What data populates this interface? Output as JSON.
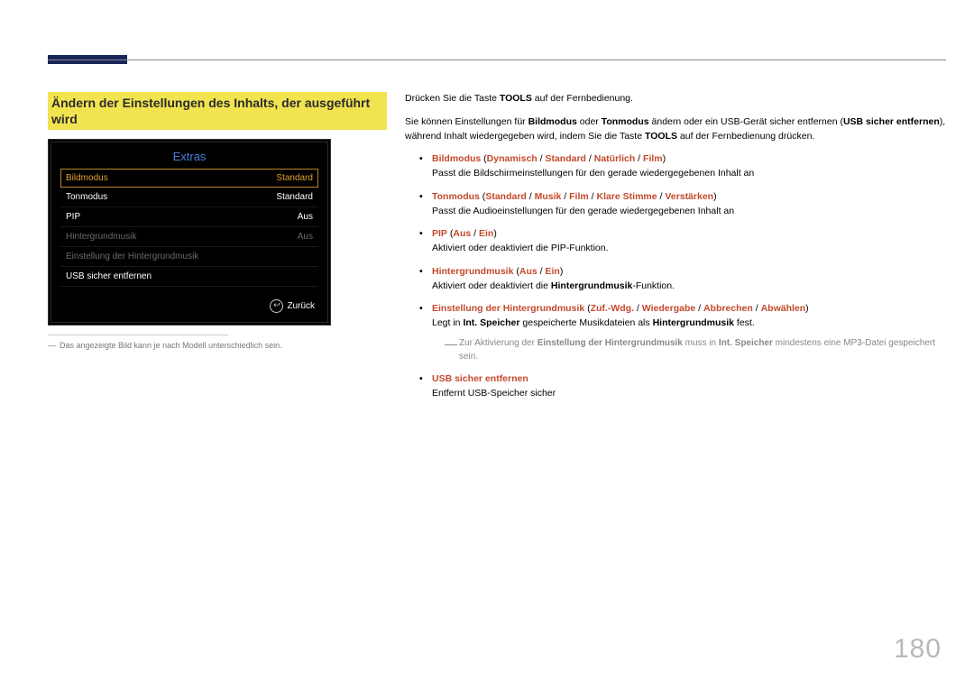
{
  "page_number": "180",
  "heading": "Ändern der Einstellungen des Inhalts, der ausgeführt wird",
  "tv_panel": {
    "title": "Extras",
    "rows": [
      {
        "label": "Bildmodus",
        "value": "Standard",
        "state": "selected"
      },
      {
        "label": "Tonmodus",
        "value": "Standard",
        "state": "light"
      },
      {
        "label": "PIP",
        "value": "Aus",
        "state": "light"
      },
      {
        "label": "Hintergrundmusik",
        "value": "Aus",
        "state": "dim"
      },
      {
        "label": "Einstellung der Hintergrundmusik",
        "value": "",
        "state": "dim"
      },
      {
        "label": "USB sicher entfernen",
        "value": "",
        "state": "light"
      }
    ],
    "footer_label": "Zurück"
  },
  "image_footnote": "Das angezeigte Bild kann je nach Modell unterschiedlich sein.",
  "body": {
    "intro1_a": "Drücken Sie die Taste ",
    "intro1_b": "TOOLS",
    "intro1_c": " auf der Fernbedienung.",
    "intro2_a": "Sie können Einstellungen für ",
    "intro2_b": "Bildmodus",
    "intro2_c": " oder ",
    "intro2_d": "Tonmodus",
    "intro2_e": " ändern oder ein USB-Gerät sicher entfernen (",
    "intro2_f": "USB sicher entfernen",
    "intro2_g": "), während Inhalt wiedergegeben wird, indem Sie die Taste ",
    "intro2_h": "TOOLS",
    "intro2_i": " auf der Fernbedienung drücken.",
    "items": [
      {
        "title_parts": [
          "Bildmodus",
          " (",
          "Dynamisch",
          " / ",
          "Standard",
          " / ",
          "Natürlich",
          " / ",
          "Film",
          ")"
        ],
        "desc": "Passt die Bildschirmeinstellungen für den gerade wiedergegebenen Inhalt an"
      },
      {
        "title_parts": [
          "Tonmodus",
          " (",
          "Standard",
          " / ",
          "Musik",
          " / ",
          "Film",
          " / ",
          "Klare Stimme",
          " / ",
          "Verstärken",
          ")"
        ],
        "desc": "Passt die Audioeinstellungen für den gerade wiedergegebenen Inhalt an"
      },
      {
        "title_parts": [
          "PIP",
          " (",
          "Aus",
          " / ",
          "Ein",
          ")"
        ],
        "desc": "Aktiviert oder deaktiviert die PIP-Funktion."
      },
      {
        "title_parts": [
          "Hintergrundmusik",
          " (",
          "Aus",
          " / ",
          "Ein",
          ")"
        ],
        "desc_parts": [
          "Aktiviert oder deaktiviert die ",
          "Hintergrundmusik",
          "-Funktion."
        ]
      },
      {
        "title_parts": [
          "Einstellung der Hintergrundmusik",
          " (",
          "Zuf.-Wdg.",
          " / ",
          "Wiedergabe",
          " / ",
          "Abbrechen",
          " / ",
          "Abwählen",
          ")"
        ],
        "desc_parts": [
          "Legt in ",
          "Int. Speicher",
          " gespeicherte Musikdateien als ",
          "Hintergrundmusik",
          " fest."
        ],
        "note_parts": [
          "Zur Aktivierung der ",
          "Einstellung der Hintergrundmusik",
          " muss in ",
          "Int. Speicher",
          " mindestens eine MP3-Datei gespeichert sein."
        ]
      },
      {
        "title_parts": [
          "USB sicher entfernen"
        ],
        "desc": "Entfernt USB-Speicher sicher"
      }
    ]
  }
}
